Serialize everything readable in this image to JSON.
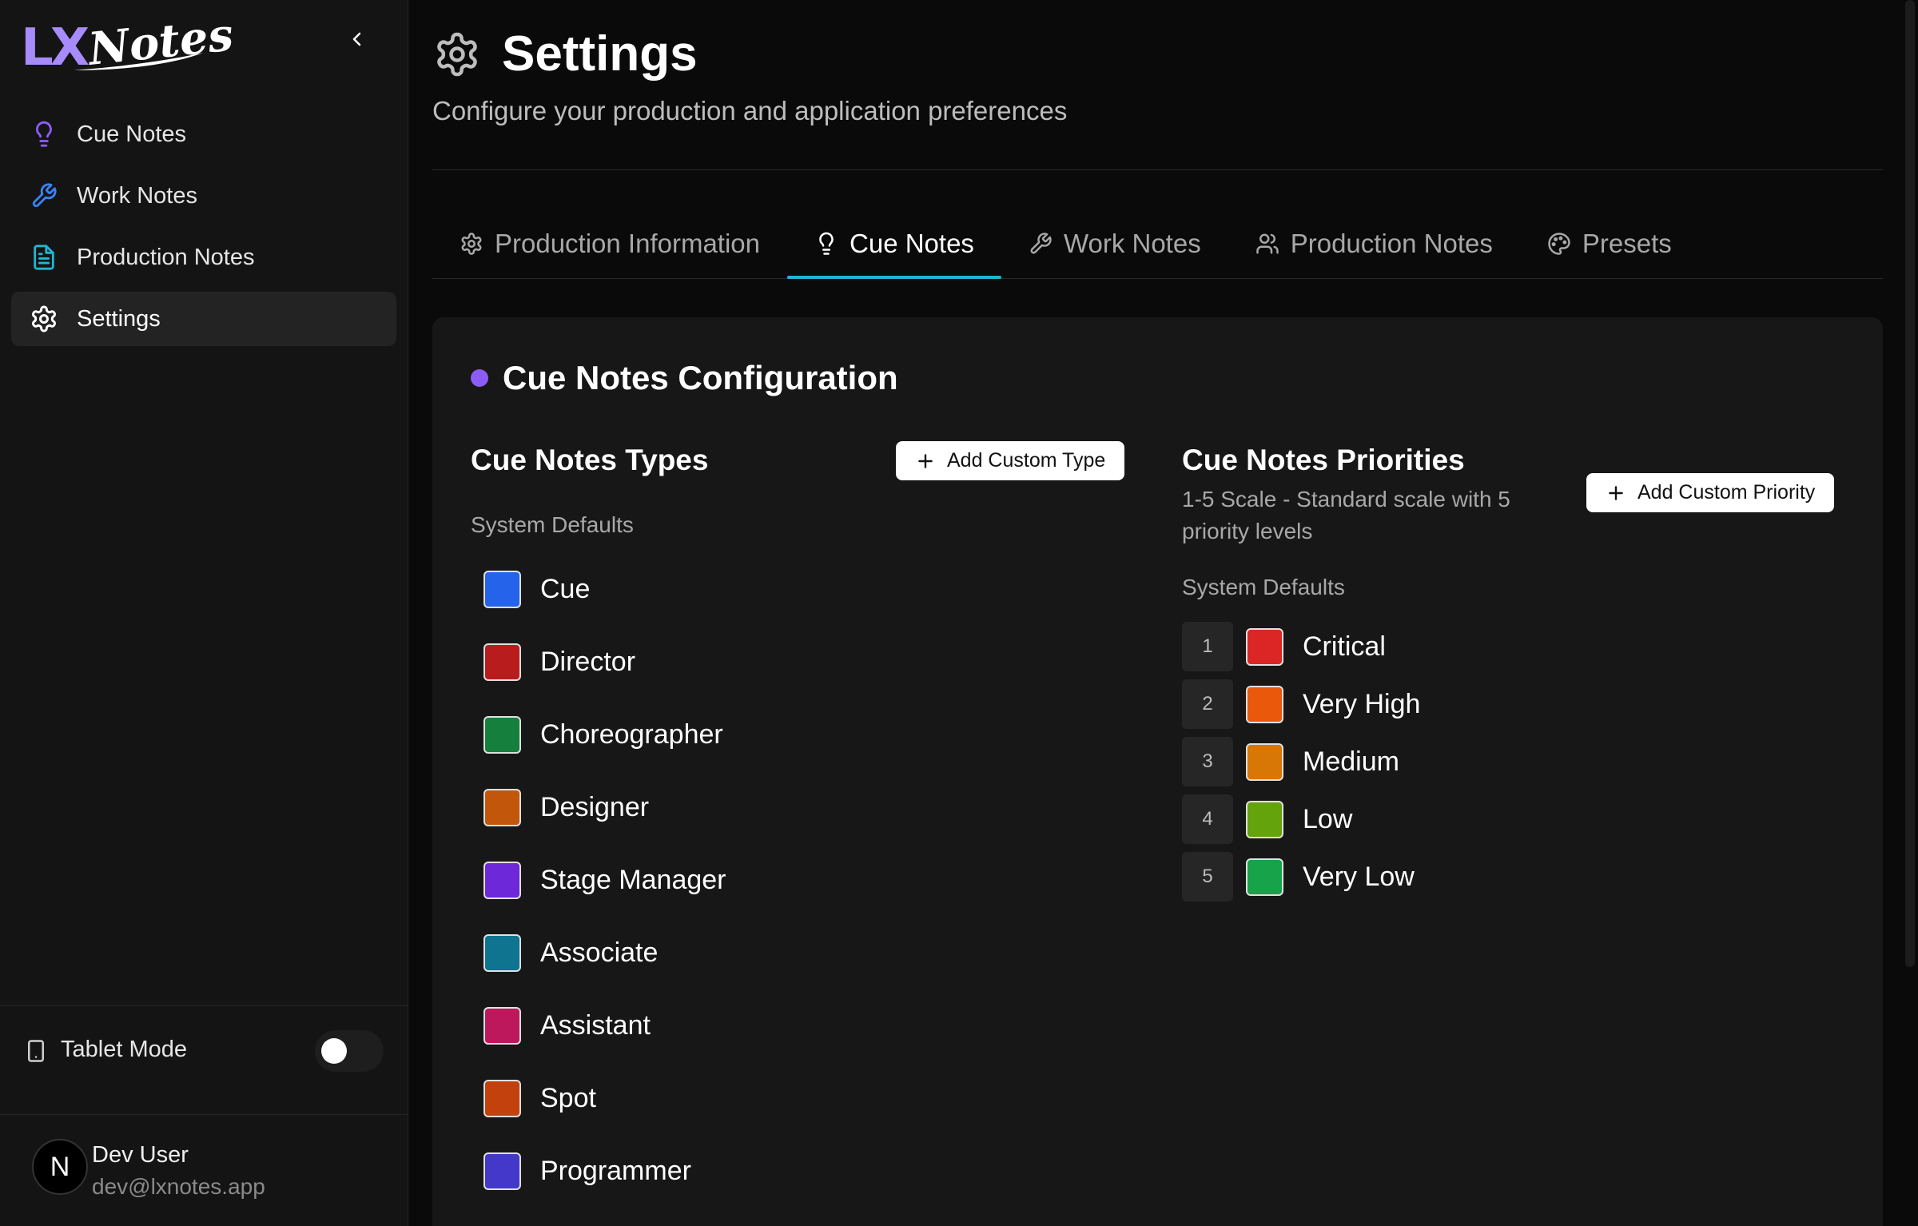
{
  "app": {
    "logo_lx": "LX",
    "logo_notes": "Notes",
    "colors": {
      "accent": "#8b5cf6",
      "tab_indicator": "#22b5d3",
      "logo_purple": "#a78bfa"
    }
  },
  "sidebar": {
    "items": [
      {
        "label": "Cue Notes",
        "icon": "lightbulb-icon",
        "color": "#8b5cf6"
      },
      {
        "label": "Work Notes",
        "icon": "wrench-icon",
        "color": "#3b82f6"
      },
      {
        "label": "Production Notes",
        "icon": "file-text-icon",
        "color": "#22b5d3"
      },
      {
        "label": "Settings",
        "icon": "gear-icon",
        "color": "#ffffff",
        "active": true
      }
    ],
    "tablet_mode_label": "Tablet Mode",
    "tablet_mode_on": false,
    "user": {
      "initial": "N",
      "name": "Dev User",
      "email": "dev@lxnotes.app"
    }
  },
  "header": {
    "title": "Settings",
    "subtitle": "Configure your production and application preferences"
  },
  "tabs": [
    {
      "label": "Production Information",
      "icon": "gear-icon"
    },
    {
      "label": "Cue Notes",
      "icon": "lightbulb-icon",
      "active": true
    },
    {
      "label": "Work Notes",
      "icon": "wrench-icon"
    },
    {
      "label": "Production Notes",
      "icon": "users-icon"
    },
    {
      "label": "Presets",
      "icon": "palette-icon"
    }
  ],
  "card": {
    "title": "Cue Notes Configuration",
    "types": {
      "title": "Cue Notes Types",
      "add_button": "Add Custom Type",
      "system_label": "System Defaults",
      "items": [
        {
          "name": "Cue",
          "color": "#2563eb"
        },
        {
          "name": "Director",
          "color": "#b91c1c"
        },
        {
          "name": "Choreographer",
          "color": "#15803d"
        },
        {
          "name": "Designer",
          "color": "#c2570c"
        },
        {
          "name": "Stage Manager",
          "color": "#6d28d9"
        },
        {
          "name": "Associate",
          "color": "#0e7490"
        },
        {
          "name": "Assistant",
          "color": "#be185d"
        },
        {
          "name": "Spot",
          "color": "#c2410c"
        },
        {
          "name": "Programmer",
          "color": "#4338ca"
        }
      ]
    },
    "priorities": {
      "title": "Cue Notes Priorities",
      "description": "1-5 Scale - Standard scale with 5 priority levels",
      "add_button": "Add Custom Priority",
      "system_label": "System Defaults",
      "items": [
        {
          "num": "1",
          "name": "Critical",
          "color": "#dc2626"
        },
        {
          "num": "2",
          "name": "Very High",
          "color": "#ea580c"
        },
        {
          "num": "3",
          "name": "Medium",
          "color": "#d97706"
        },
        {
          "num": "4",
          "name": "Low",
          "color": "#65a30d"
        },
        {
          "num": "5",
          "name": "Very Low",
          "color": "#16a34a"
        }
      ]
    }
  }
}
